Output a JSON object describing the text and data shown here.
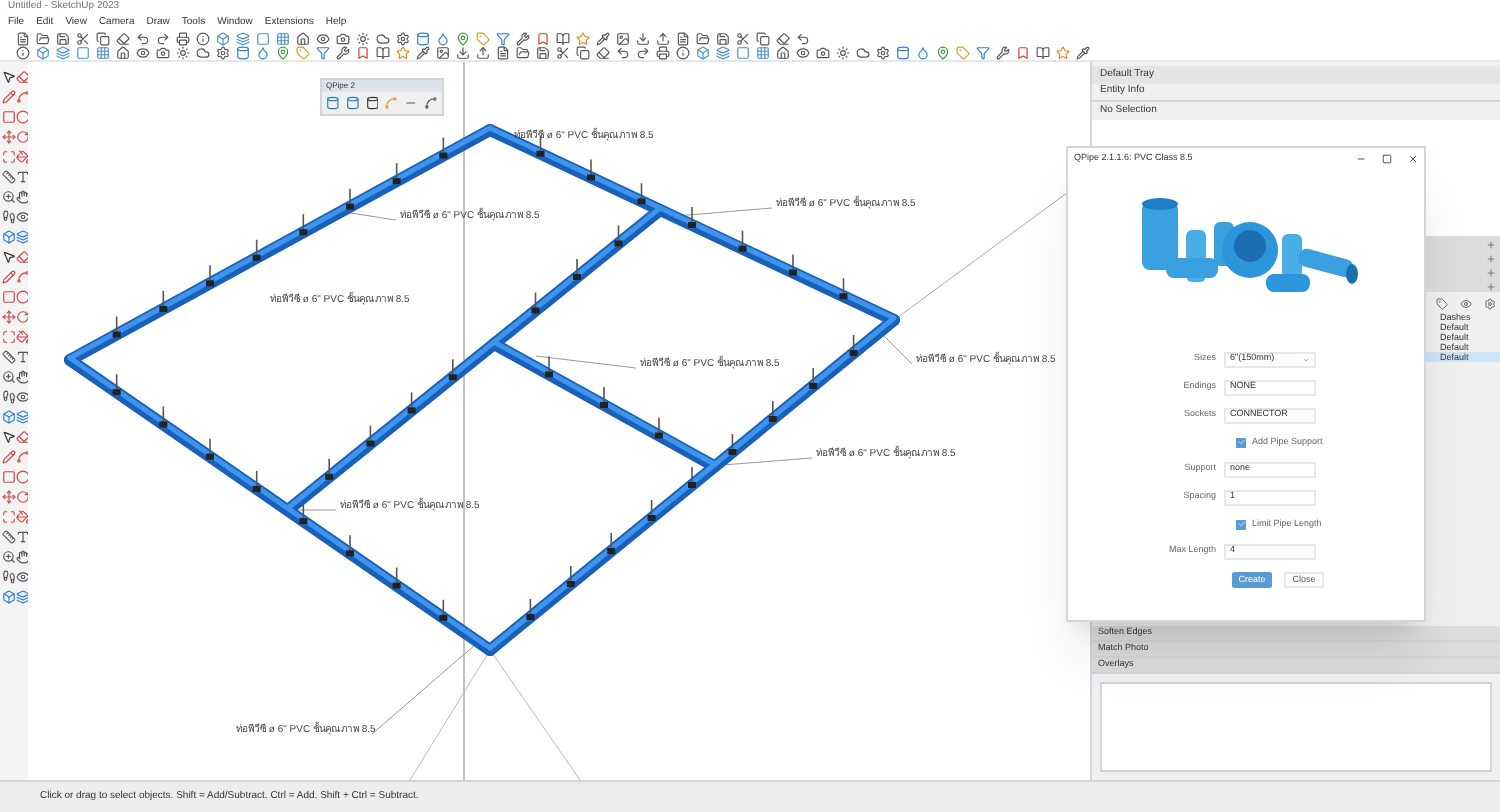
{
  "window": {
    "title": "Untitled - SketchUp 2023"
  },
  "menu": [
    "File",
    "Edit",
    "View",
    "Camera",
    "Draw",
    "Tools",
    "Window",
    "Extensions",
    "Help"
  ],
  "floating_toolbar": {
    "title": "QPipe 2"
  },
  "canvas": {
    "labels": [
      {
        "text": "ท่อพีวีซี ø 6\" PVC ชั้นคุณภาพ 8.5"
      },
      {
        "text": "ท่อพีวีซี ø 6\" PVC ชั้นคุณภาพ 8.5"
      },
      {
        "text": "ท่อพีวีซี ø 6\" PVC ชั้นคุณภาพ 8.5"
      },
      {
        "text": "ท่อพีวีซี ø 6\" PVC ชั้นคุณภาพ 8.5"
      },
      {
        "text": "ท่อพีวีซี ø 6\" PVC ชั้นคุณภาพ 8.5"
      },
      {
        "text": "ท่อพีวีซี ø 6\" PVC ชั้นคุณภาพ 8.5"
      },
      {
        "text": "ท่อพีวีซี ø 6\" PVC ชั้นคุณภาพ 8.5"
      },
      {
        "text": "ท่อพีวีซี ø 6\" PVC ชั้นคุณภาพ 8.5"
      },
      {
        "text": "ท่อพีวีซี ø 6\" PVC ชั้นคุณภาพ 8.5"
      }
    ]
  },
  "dialog": {
    "title": "QPipe 2.1.1.6: PVC Class 8.5",
    "fields": [
      {
        "kind": "select",
        "label": "Sizes",
        "value": "6\"(150mm)"
      },
      {
        "kind": "text",
        "label": "Endings",
        "value": "NONE"
      },
      {
        "kind": "text",
        "label": "Sockets",
        "value": "CONNECTOR"
      },
      {
        "kind": "checkbox",
        "label": "Add Pipe Support",
        "checked": true
      },
      {
        "kind": "text",
        "label": "Support",
        "value": "none"
      },
      {
        "kind": "text",
        "label": "Spacing",
        "value": "1"
      },
      {
        "kind": "checkbox",
        "label": "Limit Pipe Length",
        "checked": true
      },
      {
        "kind": "text",
        "label": "Max Length",
        "value": "4"
      }
    ],
    "buttons": [
      {
        "label": "Create",
        "kind": "primary"
      },
      {
        "label": "Close",
        "kind": "secondary"
      }
    ]
  },
  "tray": {
    "title": "Default Tray",
    "entity_info": {
      "title": "Entity Info",
      "text": "No Selection"
    },
    "tags": [
      {
        "name": "Dashes",
        "selected": false
      },
      {
        "name": "Default",
        "selected": false
      },
      {
        "name": "Default",
        "selected": false
      },
      {
        "name": "Default",
        "selected": false
      },
      {
        "name": "Default",
        "selected": true
      }
    ],
    "panels": [
      "Soften Edges",
      "Match Photo",
      "Overlays"
    ]
  },
  "status_bar": {
    "text": "Click or drag to select objects. Shift = Add/Subtract. Ctrl = Add. Shift + Ctrl = Subtract."
  }
}
